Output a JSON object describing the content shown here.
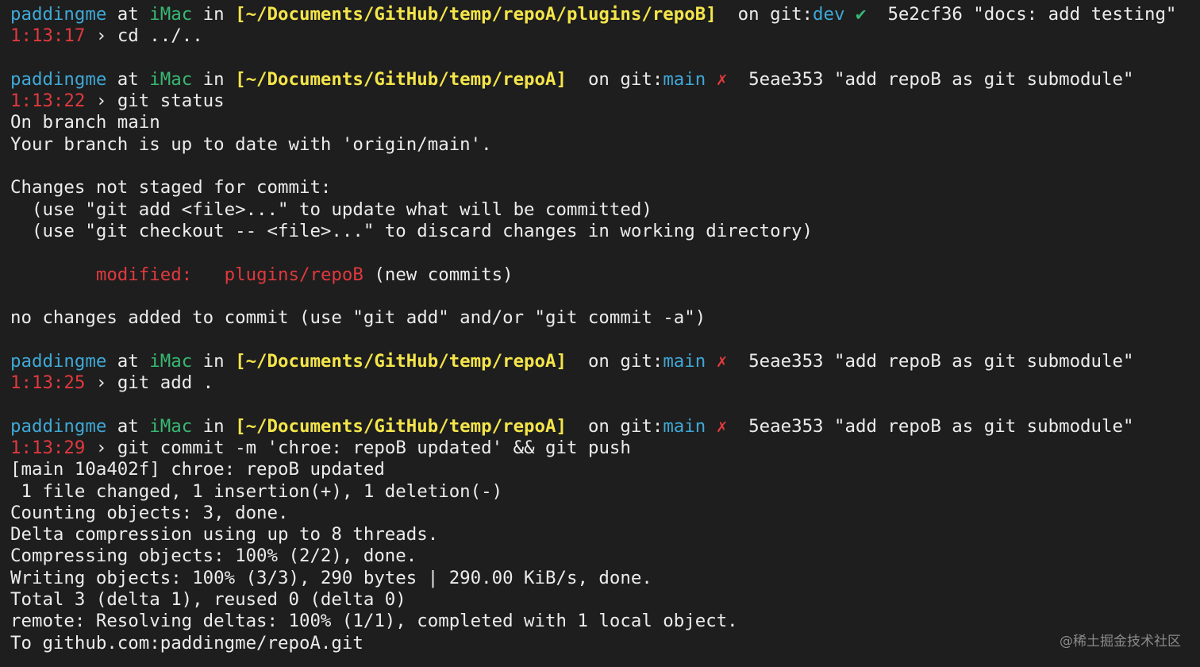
{
  "colors": {
    "background": "#1e1e1e",
    "text": "#ececec",
    "user": "#3fa8d6",
    "host": "#38b873",
    "path": "#f4e54a",
    "branch": "#3fa8d6",
    "clean_mark": "#38b873",
    "dirty_mark": "#e0393e",
    "time": "#e0393e",
    "modified": "#e0393e"
  },
  "prompts": [
    {
      "user": "paddingme",
      "at": " at ",
      "host": "iMac",
      "in": " in ",
      "path": "[~/Documents/GitHub/temp/repoA/plugins/repoB]",
      "on": "  on git:",
      "branch": "dev",
      "mark": " ✔",
      "sep": "  ",
      "commit": "5e2cf36 \"docs: add testing\"",
      "time": "1:13:17",
      "arrow": " › ",
      "command": "cd ../.."
    },
    {
      "user": "paddingme",
      "at": " at ",
      "host": "iMac",
      "in": " in ",
      "path": "[~/Documents/GitHub/temp/repoA]",
      "on": "  on git:",
      "branch": "main",
      "mark": " ✗",
      "sep": "  ",
      "commit": "5eae353 \"add repoB as git submodule\"",
      "time": "1:13:22",
      "arrow": " › ",
      "command": "git status"
    },
    {
      "user": "paddingme",
      "at": " at ",
      "host": "iMac",
      "in": " in ",
      "path": "[~/Documents/GitHub/temp/repoA]",
      "on": "  on git:",
      "branch": "main",
      "mark": " ✗",
      "sep": "  ",
      "commit": "5eae353 \"add repoB as git submodule\"",
      "time": "1:13:25",
      "arrow": " › ",
      "command": "git add ."
    },
    {
      "user": "paddingme",
      "at": " at ",
      "host": "iMac",
      "in": " in ",
      "path": "[~/Documents/GitHub/temp/repoA]",
      "on": "  on git:",
      "branch": "main",
      "mark": " ✗",
      "sep": "  ",
      "commit": "5eae353 \"add repoB as git submodule\"",
      "time": "1:13:29",
      "arrow": " › ",
      "command": "git commit -m 'chroe: repoB updated' && git push"
    }
  ],
  "status_output": {
    "on_branch": "On branch main",
    "up_to_date": "Your branch is up to date with 'origin/main'.",
    "changes_header": "Changes not staged for commit:",
    "hint_add": "  (use \"git add <file>...\" to update what will be committed)",
    "hint_checkout": "  (use \"git checkout -- <file>...\" to discard changes in working directory)",
    "modified_indent": "        ",
    "modified_label": "modified:",
    "modified_gap": "   ",
    "modified_file": "plugins/repoB",
    "modified_note": " (new commits)",
    "no_changes": "no changes added to commit (use \"git add\" and/or \"git commit -a\")"
  },
  "commit_output": [
    "[main 10a402f] chroe: repoB updated",
    " 1 file changed, 1 insertion(+), 1 deletion(-)",
    "Counting objects: 3, done.",
    "Delta compression using up to 8 threads.",
    "Compressing objects: 100% (2/2), done.",
    "Writing objects: 100% (3/3), 290 bytes | 290.00 KiB/s, done.",
    "Total 3 (delta 1), reused 0 (delta 0)",
    "remote: Resolving deltas: 100% (1/1), completed with 1 local object.",
    "To github.com:paddingme/repoA.git"
  ],
  "watermark": "@稀土掘金技术社区"
}
